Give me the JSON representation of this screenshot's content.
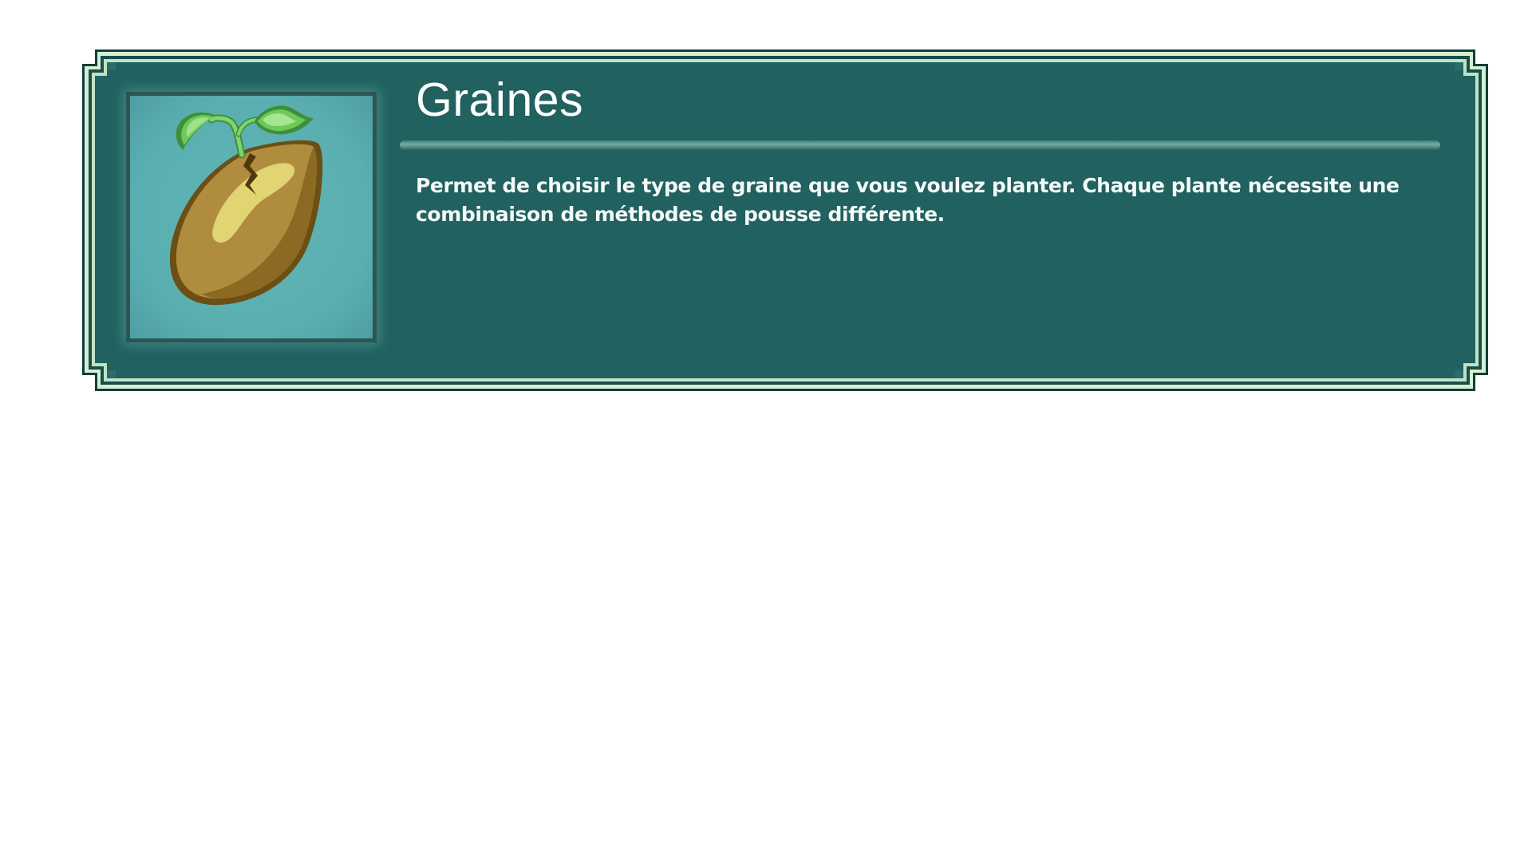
{
  "item": {
    "title": "Graines",
    "description": "Permet de choisir le type de graine que vous voulez planter. Chaque plante nécessite une combinaison de méthodes de pousse différente.",
    "icon": "seed-sprout-icon"
  },
  "colors": {
    "panel_background": "#21615f",
    "frame_highlight": "#d8efcf",
    "frame_dark": "#0e3f3e",
    "icon_background": "#5aaeb0",
    "seed_body": "#b08c3f",
    "sprout_leaf": "#6cc95a"
  }
}
